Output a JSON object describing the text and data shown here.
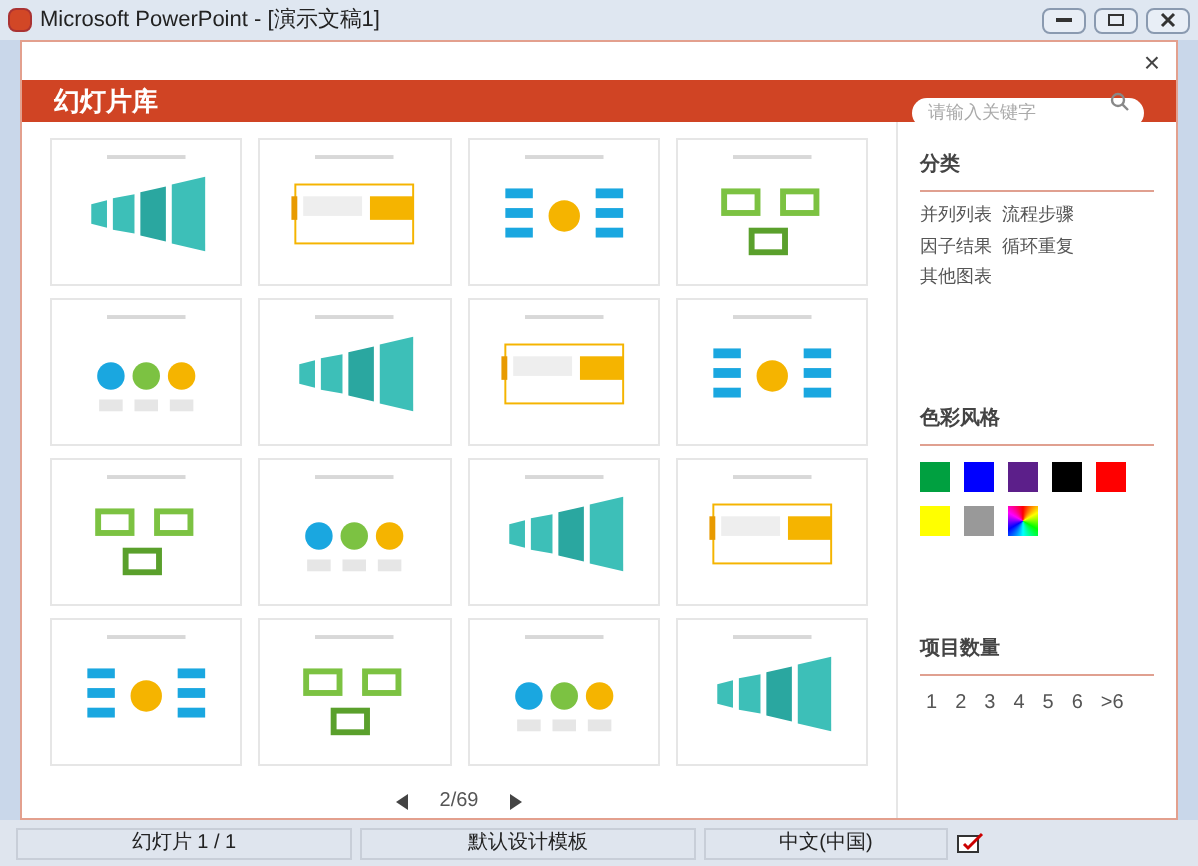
{
  "window": {
    "title": "Microsoft PowerPoint - [演示文稿1]"
  },
  "dialog": {
    "close": "×",
    "title": "幻灯片库",
    "search": {
      "placeholder": "请输入关键字"
    }
  },
  "pagination": {
    "page": "2/69"
  },
  "sidebar": {
    "category": {
      "title": "分类",
      "items": [
        "并列列表",
        "流程步骤",
        "因子结果",
        "循环重复",
        "其他图表"
      ]
    },
    "colors": {
      "title": "色彩风格",
      "swatches": [
        {
          "kind": "solid",
          "color": "#00a040"
        },
        {
          "kind": "solid",
          "color": "#0000ff"
        },
        {
          "kind": "solid",
          "color": "#5c1f8a"
        },
        {
          "kind": "solid",
          "color": "#000000"
        },
        {
          "kind": "solid",
          "color": "#ff0000"
        },
        {
          "kind": "solid",
          "color": "#ffff00"
        },
        {
          "kind": "solid",
          "color": "#999999"
        },
        {
          "kind": "gradient"
        }
      ]
    },
    "count": {
      "title": "项目数量",
      "items": [
        "1",
        "2",
        "3",
        "4",
        "5",
        "6",
        ">6"
      ]
    }
  },
  "status_bar": [
    "幻灯片 1 / 1",
    "默认设计模板",
    "中文(中国)"
  ]
}
